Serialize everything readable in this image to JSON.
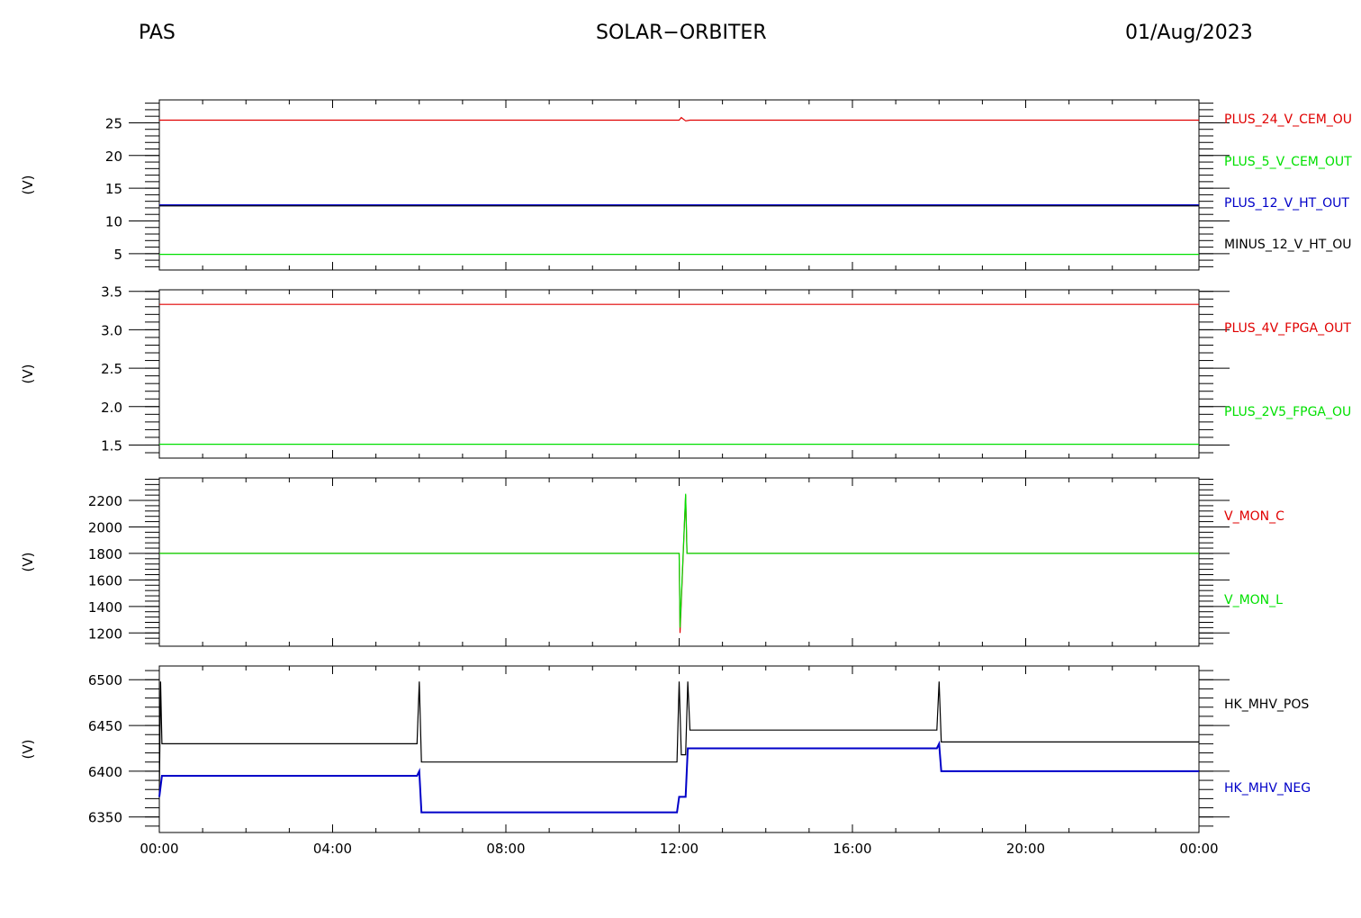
{
  "header": {
    "left": "PAS",
    "center": "SOLAR−ORBITER",
    "right": "01/Aug/2023"
  },
  "colors": {
    "red": "#e00000",
    "green": "#00e000",
    "blue": "#0000c8",
    "black": "#000000"
  },
  "chart_data": [
    {
      "type": "line",
      "ylabel": "(V)",
      "ylim": [
        2.5,
        28.5
      ],
      "yticks": [
        5,
        10,
        15,
        20,
        25
      ],
      "ytick_labels": [
        "5",
        "10",
        "15",
        "20",
        "25"
      ],
      "x": [
        "00:00",
        "04:00",
        "08:00",
        "12:00",
        "16:00",
        "20:00",
        "00:00"
      ],
      "series": [
        {
          "name": "PLUS_24_V_CEM_OU",
          "color": "red",
          "points": [
            [
              0,
              25.4
            ],
            [
              12.0,
              25.4
            ],
            [
              12.05,
              25.8
            ],
            [
              12.15,
              25.3
            ],
            [
              12.25,
              25.4
            ],
            [
              24,
              25.4
            ]
          ]
        },
        {
          "name": "PLUS_5_V_CEM_OUT",
          "color": "green",
          "points": [
            [
              0,
              4.9
            ],
            [
              24,
              4.9
            ]
          ]
        },
        {
          "name": "PLUS_12_V_HT_OUT",
          "color": "blue",
          "points": [
            [
              0,
              12.4
            ],
            [
              24,
              12.4
            ]
          ]
        },
        {
          "name": "MINUS_12_V_HT_OU",
          "color": "black",
          "points": [
            [
              0,
              12.3
            ],
            [
              24,
              12.3
            ]
          ]
        }
      ]
    },
    {
      "type": "line",
      "ylabel": "(V)",
      "ylim": [
        1.33,
        3.52
      ],
      "yticks": [
        1.5,
        2.0,
        2.5,
        3.0,
        3.5
      ],
      "ytick_labels": [
        "1.5",
        "2.0",
        "2.5",
        "3.0",
        "3.5"
      ],
      "x": [
        "00:00",
        "04:00",
        "08:00",
        "12:00",
        "16:00",
        "20:00",
        "00:00"
      ],
      "series": [
        {
          "name": "PLUS_4V_FPGA_OUT",
          "color": "red",
          "points": [
            [
              0,
              3.33
            ],
            [
              24,
              3.33
            ]
          ]
        },
        {
          "name": "PLUS_2V5_FPGA_OU",
          "color": "green",
          "points": [
            [
              0,
              1.51
            ],
            [
              24,
              1.51
            ]
          ]
        }
      ]
    },
    {
      "type": "line",
      "ylabel": "(V)",
      "ylim": [
        1100,
        2370
      ],
      "yticks": [
        1200,
        1400,
        1600,
        1800,
        2000,
        2200
      ],
      "ytick_labels": [
        "1200",
        "1400",
        "1600",
        "1800",
        "2000",
        "2200"
      ],
      "x": [
        "00:00",
        "04:00",
        "08:00",
        "12:00",
        "16:00",
        "20:00",
        "00:00"
      ],
      "series": [
        {
          "name": "V_MON_C",
          "color": "red",
          "points": [
            [
              0,
              1800
            ],
            [
              12.0,
              1800
            ],
            [
              12.02,
              1200
            ],
            [
              12.15,
              2240
            ],
            [
              12.18,
              1800
            ],
            [
              24,
              1800
            ]
          ]
        },
        {
          "name": "V_MON_L",
          "color": "green",
          "points": [
            [
              0,
              1800
            ],
            [
              12.0,
              1800
            ],
            [
              12.02,
              1240
            ],
            [
              12.15,
              2250
            ],
            [
              12.18,
              1800
            ],
            [
              24,
              1800
            ]
          ]
        }
      ]
    },
    {
      "type": "line",
      "ylabel": "(V)",
      "ylim": [
        6333,
        6515
      ],
      "yticks": [
        6350,
        6400,
        6450,
        6500
      ],
      "ytick_labels": [
        "6350",
        "6400",
        "6450",
        "6500"
      ],
      "x": [
        "00:00",
        "04:00",
        "08:00",
        "12:00",
        "16:00",
        "20:00",
        "00:00"
      ],
      "xtick_labels": [
        "00:00",
        "04:00",
        "08:00",
        "12:00",
        "16:00",
        "20:00",
        "00:00"
      ],
      "series": [
        {
          "name": "HK_MHV_POS",
          "color": "black",
          "points": [
            [
              0,
              6375
            ],
            [
              0.03,
              6498
            ],
            [
              0.06,
              6430
            ],
            [
              5.95,
              6430
            ],
            [
              6.0,
              6498
            ],
            [
              6.05,
              6410
            ],
            [
              11.95,
              6410
            ],
            [
              12.0,
              6498
            ],
            [
              12.05,
              6418
            ],
            [
              12.15,
              6418
            ],
            [
              12.2,
              6498
            ],
            [
              12.25,
              6445
            ],
            [
              17.95,
              6445
            ],
            [
              18.0,
              6498
            ],
            [
              18.05,
              6432
            ],
            [
              24,
              6432
            ]
          ]
        },
        {
          "name": "HK_MHV_NEG",
          "color": "blue",
          "points": [
            [
              0,
              6372
            ],
            [
              0.06,
              6395
            ],
            [
              5.95,
              6395
            ],
            [
              6.0,
              6400
            ],
            [
              6.05,
              6355
            ],
            [
              11.95,
              6355
            ],
            [
              12.0,
              6372
            ],
            [
              12.15,
              6372
            ],
            [
              12.2,
              6425
            ],
            [
              17.95,
              6425
            ],
            [
              18.0,
              6430
            ],
            [
              18.05,
              6400
            ],
            [
              24,
              6400
            ]
          ]
        }
      ]
    }
  ]
}
